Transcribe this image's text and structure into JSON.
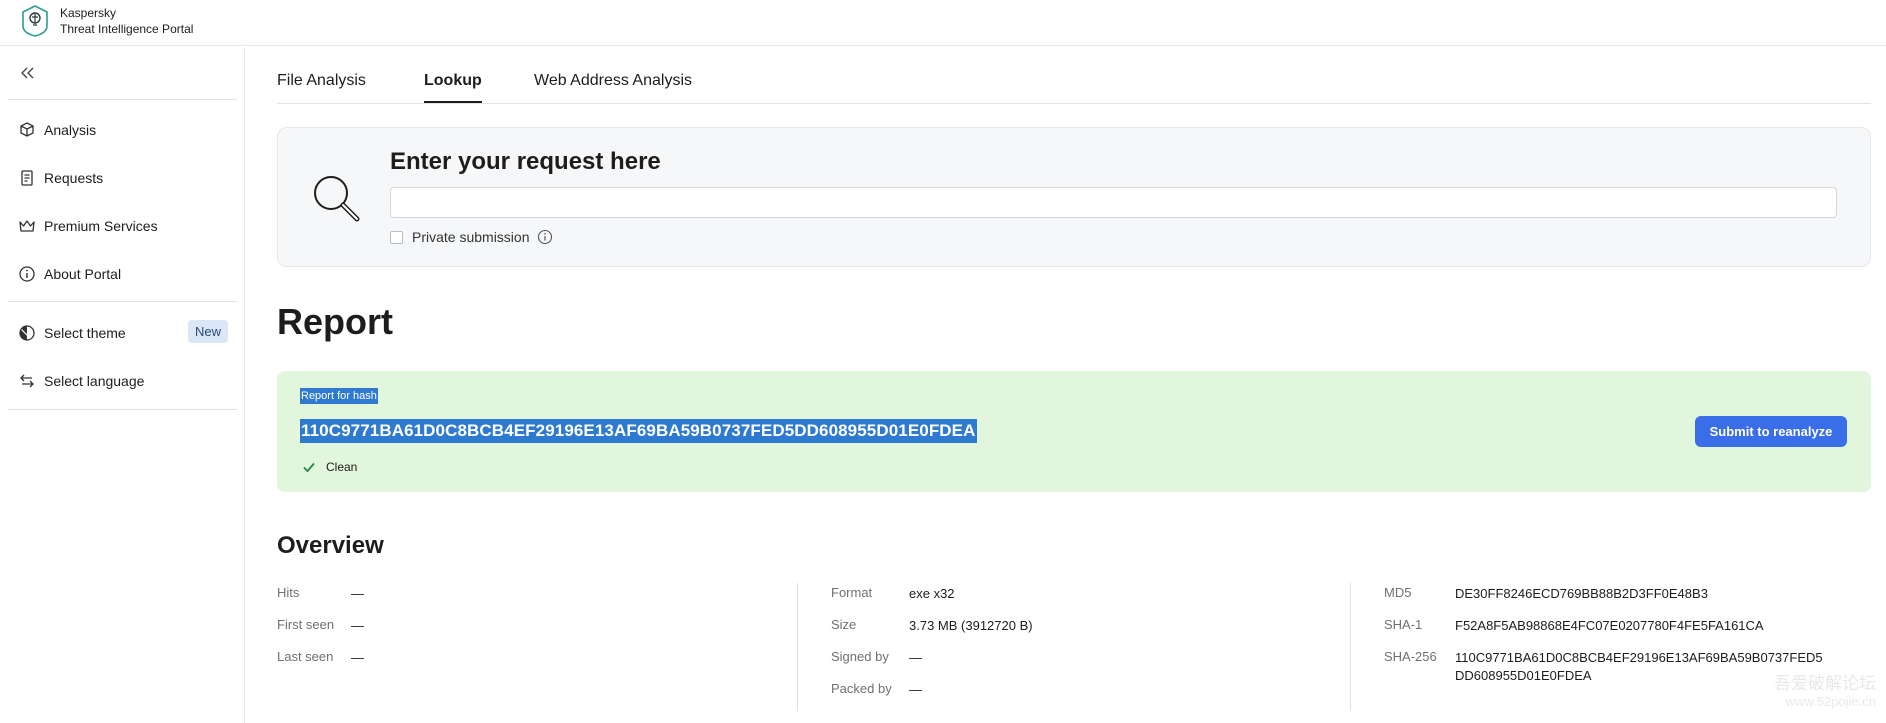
{
  "header": {
    "brand_line1": "Kaspersky",
    "brand_line2": "Threat Intelligence Portal"
  },
  "sidebar": {
    "items": [
      {
        "label": "Analysis",
        "icon": "cube-icon"
      },
      {
        "label": "Requests",
        "icon": "document-icon"
      },
      {
        "label": "Premium Services",
        "icon": "crown-icon"
      },
      {
        "label": "About Portal",
        "icon": "info-icon"
      }
    ],
    "theme_label": "Select theme",
    "theme_badge": "New",
    "language_label": "Select language"
  },
  "tabs": [
    {
      "label": "File Analysis",
      "active": false
    },
    {
      "label": "Lookup",
      "active": true
    },
    {
      "label": "Web Address Analysis",
      "active": false
    }
  ],
  "search": {
    "title": "Enter your request here",
    "value": "",
    "placeholder": "",
    "private_label": "Private submission"
  },
  "report": {
    "heading": "Report",
    "caption": "Report for hash",
    "hash": "110C9771BA61D0C8BCB4EF29196E13AF69BA59B0737FED5DD608955D01E0FDEA",
    "status": "Clean",
    "reanalyze_label": "Submit to reanalyze"
  },
  "overview": {
    "heading": "Overview",
    "col1": [
      {
        "label": "Hits",
        "value": "—"
      },
      {
        "label": "First seen",
        "value": "—"
      },
      {
        "label": "Last seen",
        "value": "—"
      }
    ],
    "col2": [
      {
        "label": "Format",
        "value": "exe x32"
      },
      {
        "label": "Size",
        "value": "3.73 MB (3912720 B)"
      },
      {
        "label": "Signed by",
        "value": "—"
      },
      {
        "label": "Packed by",
        "value": "—"
      }
    ],
    "col3": [
      {
        "label": "MD5",
        "value": "DE30FF8246ECD769BB88B2D3FF0E48B3"
      },
      {
        "label": "SHA-1",
        "value": "F52A8F5AB98868E4FC07E0207780F4FE5FA161CA"
      },
      {
        "label": "SHA-256",
        "value_line1": "110C9771BA61D0C8BCB4EF29196E13AF69BA59B0737FED5",
        "value_line2": "DD608955D01E0FDEA"
      }
    ]
  },
  "watermark": {
    "line1": "吾爱破解论坛",
    "line2": "www.52pojie.cn"
  },
  "colors": {
    "accent": "#3a6ee8",
    "selection": "#2e7ad1",
    "success_bg": "#e2f5dd",
    "success_icon": "#1f8a4c"
  }
}
